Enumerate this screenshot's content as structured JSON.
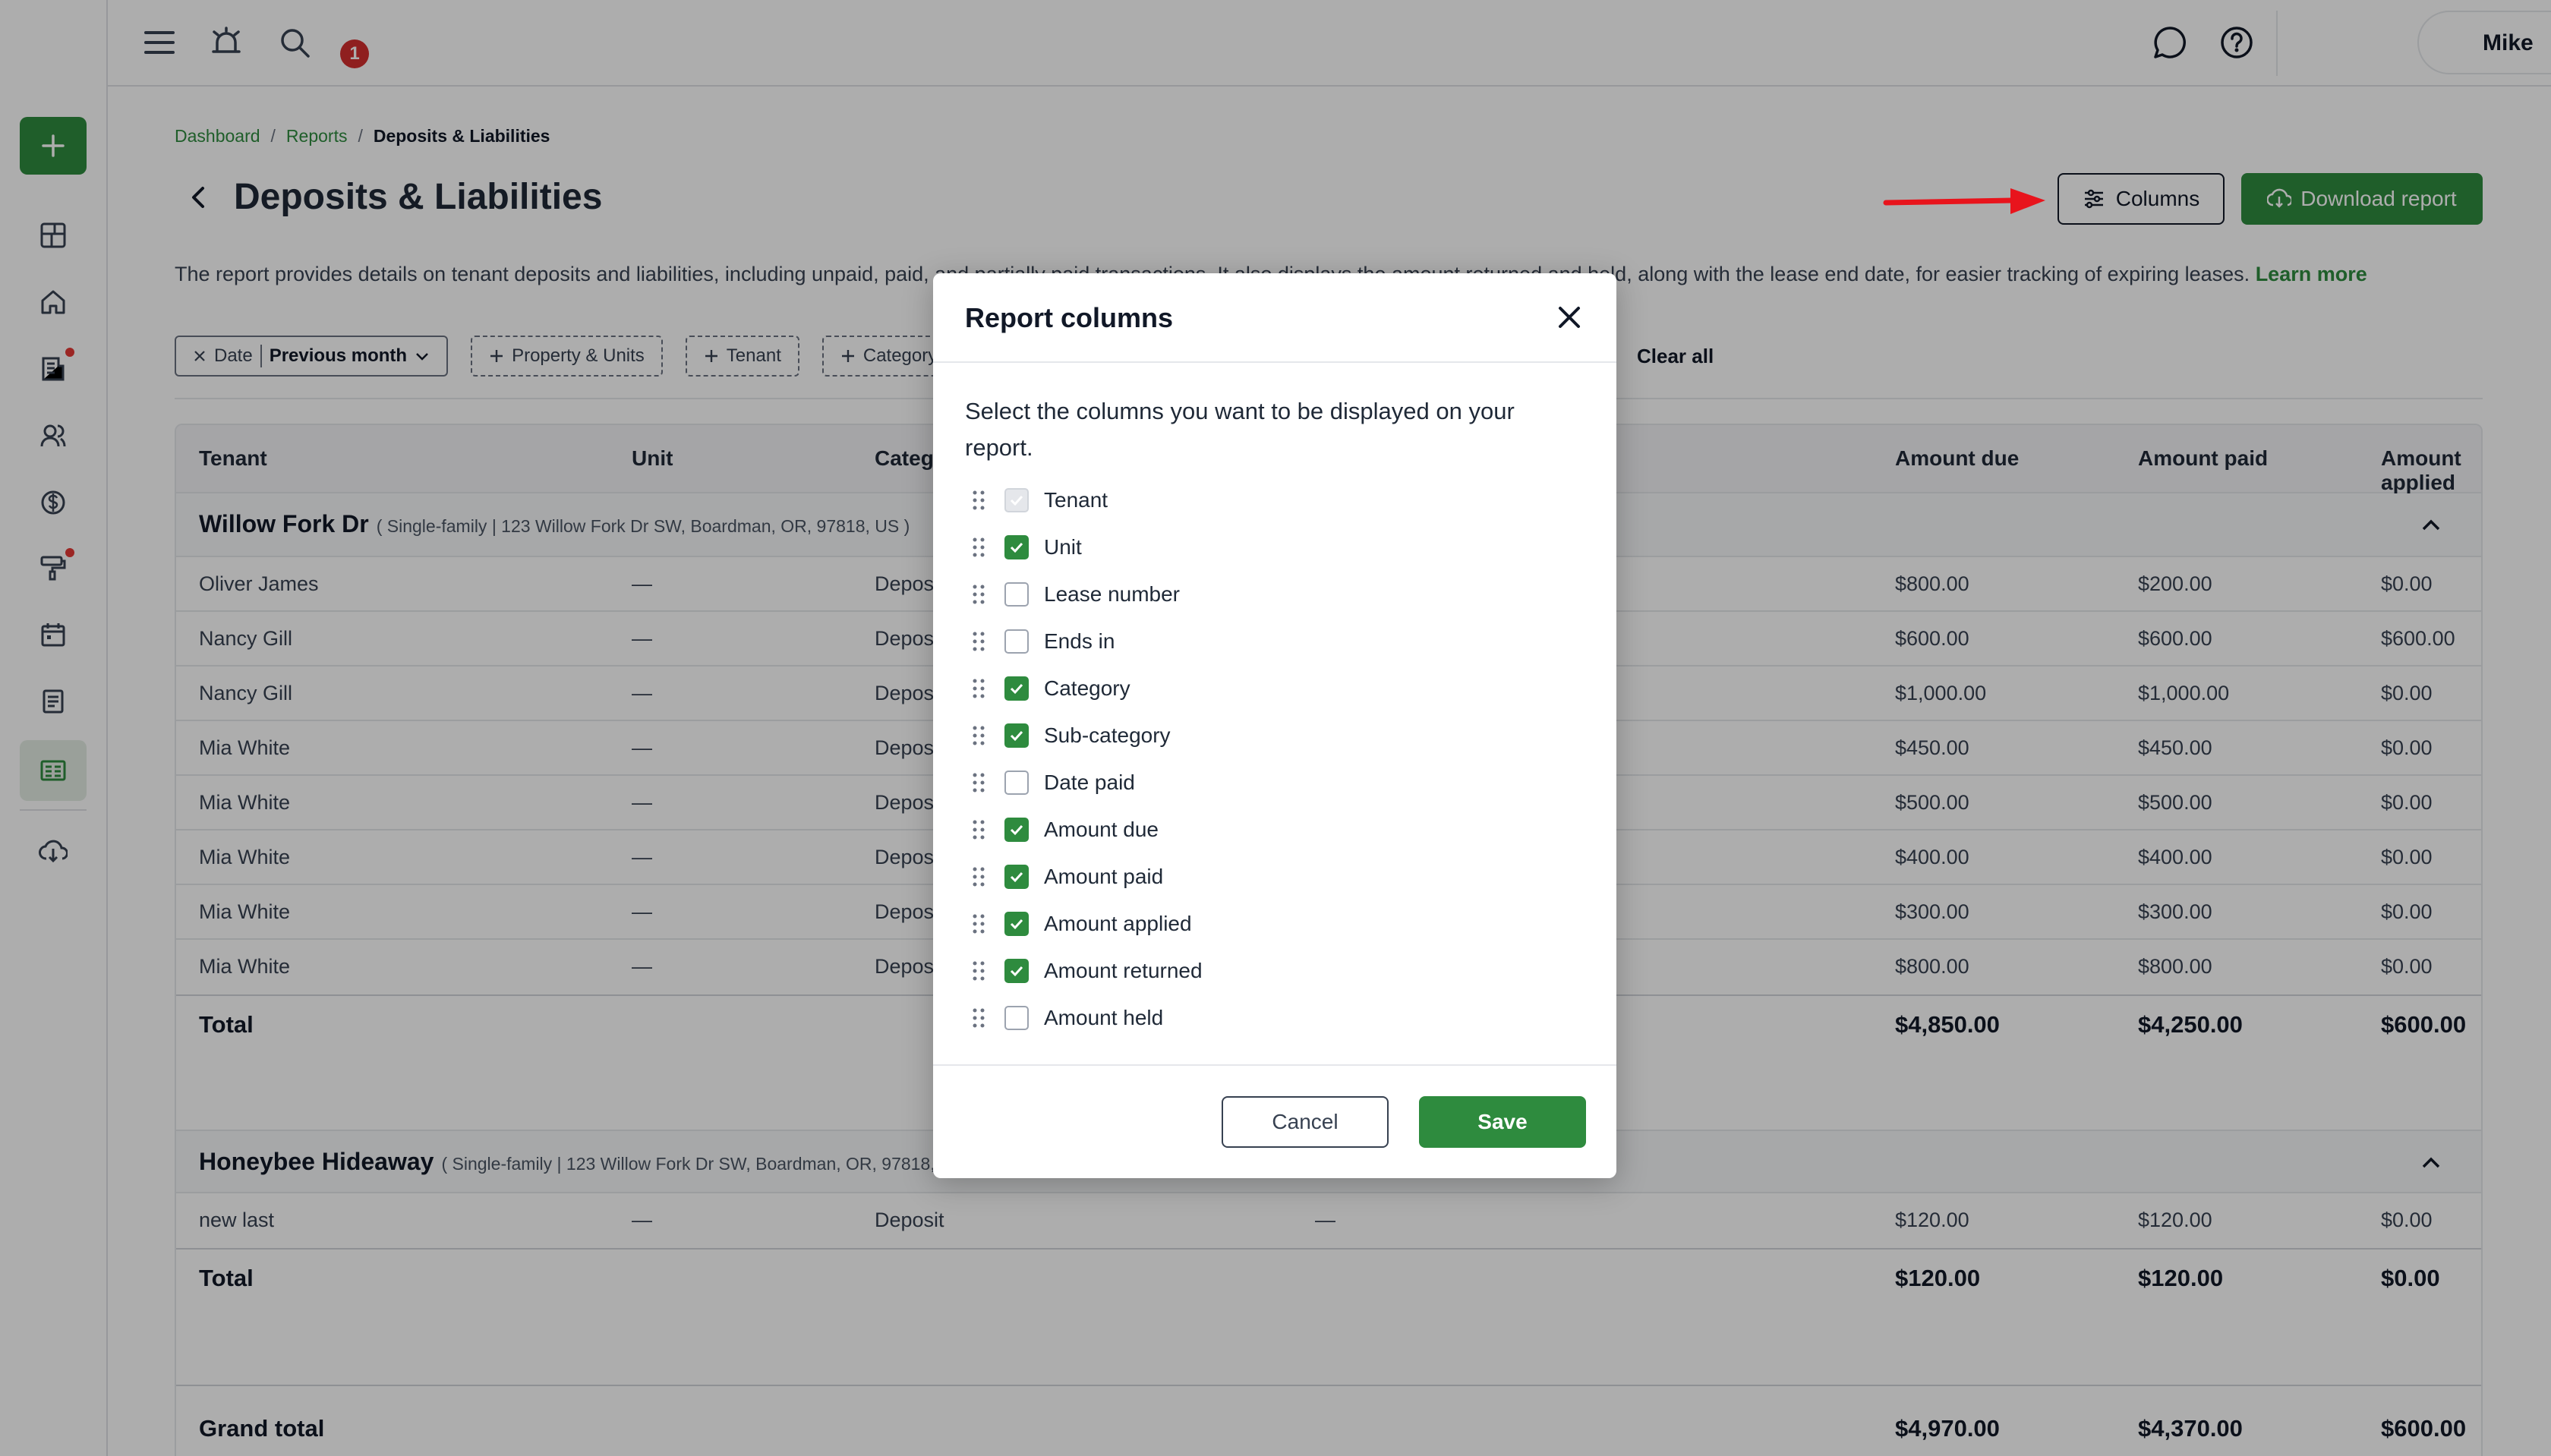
{
  "topbar": {
    "notification_count": "1",
    "user_name": "Mike"
  },
  "sidebar": {
    "items": [
      {
        "icon": "dashboard-icon"
      },
      {
        "icon": "home-icon"
      },
      {
        "icon": "reports-building-icon",
        "badge": true
      },
      {
        "icon": "people-icon"
      },
      {
        "icon": "dollar-icon"
      },
      {
        "icon": "maintenance-roller-icon",
        "badge": true
      },
      {
        "icon": "calendar-icon"
      },
      {
        "icon": "document-icon"
      },
      {
        "icon": "reports-icon",
        "active": true
      },
      {
        "icon": "download-cloud-icon"
      }
    ]
  },
  "breadcrumb": {
    "items": [
      "Dashboard",
      "Reports",
      "Deposits & Liabilities"
    ]
  },
  "page": {
    "title": "Deposits & Liabilities",
    "columns_label": "Columns",
    "download_label": "Download report",
    "description": "The report provides details on tenant deposits and liabilities, including unpaid, paid, and partially paid transactions. It also displays the amount returned and held, along with the lease end date, for easier tracking of expiring leases.",
    "learn_more": "Learn more"
  },
  "filters": {
    "date_label": "Date",
    "date_value": "Previous month",
    "chips": [
      "Property & Units",
      "Tenant",
      "Category"
    ],
    "clear_all": "Clear all"
  },
  "table": {
    "headers": {
      "tenant": "Tenant",
      "unit": "Unit",
      "category": "Category",
      "amount_due": "Amount due",
      "amount_paid": "Amount paid",
      "amount_applied": "Amount applied"
    },
    "groups": [
      {
        "name": "Willow Fork Dr",
        "address": "( Single-family | 123 Willow Fork Dr SW, Boardman, OR, 97818, US )",
        "rows": [
          {
            "tenant": "Oliver James",
            "unit": "—",
            "category": "Deposit",
            "due": "$800.00",
            "paid": "$200.00",
            "applied": "$0.00"
          },
          {
            "tenant": "Nancy Gill",
            "unit": "—",
            "category": "Deposit",
            "due": "$600.00",
            "paid": "$600.00",
            "applied": "$600.00"
          },
          {
            "tenant": "Nancy Gill",
            "unit": "—",
            "category": "Deposit",
            "due": "$1,000.00",
            "paid": "$1,000.00",
            "applied": "$0.00"
          },
          {
            "tenant": "Mia White",
            "unit": "—",
            "category": "Deposit",
            "due": "$450.00",
            "paid": "$450.00",
            "applied": "$0.00"
          },
          {
            "tenant": "Mia White",
            "unit": "—",
            "category": "Deposit",
            "due": "$500.00",
            "paid": "$500.00",
            "applied": "$0.00"
          },
          {
            "tenant": "Mia White",
            "unit": "—",
            "category": "Deposit",
            "due": "$400.00",
            "paid": "$400.00",
            "applied": "$0.00"
          },
          {
            "tenant": "Mia White",
            "unit": "—",
            "category": "Deposit",
            "due": "$300.00",
            "paid": "$300.00",
            "applied": "$0.00"
          },
          {
            "tenant": "Mia White",
            "unit": "—",
            "category": "Deposit",
            "due": "$800.00",
            "paid": "$800.00",
            "applied": "$0.00"
          }
        ],
        "total": {
          "label": "Total",
          "due": "$4,850.00",
          "paid": "$4,250.00",
          "applied": "$600.00"
        }
      },
      {
        "name": "Honeybee Hideaway",
        "address": "( Single-family | 123 Willow Fork Dr SW, Boardman, OR, 97818, US )",
        "rows": [
          {
            "tenant": "new last",
            "unit": "—",
            "category": "Deposit",
            "subcategory": "—",
            "due": "$120.00",
            "paid": "$120.00",
            "applied": "$0.00"
          }
        ],
        "total": {
          "label": "Total",
          "due": "$120.00",
          "paid": "$120.00",
          "applied": "$0.00"
        }
      }
    ],
    "grand_total": {
      "label": "Grand total",
      "due": "$4,970.00",
      "paid": "$4,370.00",
      "applied": "$600.00"
    }
  },
  "modal": {
    "title": "Report columns",
    "description": "Select the columns you want to be displayed on your report.",
    "columns": [
      {
        "label": "Tenant",
        "state": "disabled-checked"
      },
      {
        "label": "Unit",
        "state": "checked"
      },
      {
        "label": "Lease number",
        "state": "unchecked"
      },
      {
        "label": "Ends in",
        "state": "unchecked"
      },
      {
        "label": "Category",
        "state": "checked"
      },
      {
        "label": "Sub-category",
        "state": "checked"
      },
      {
        "label": "Date paid",
        "state": "unchecked"
      },
      {
        "label": "Amount due",
        "state": "checked"
      },
      {
        "label": "Amount paid",
        "state": "checked"
      },
      {
        "label": "Amount applied",
        "state": "checked"
      },
      {
        "label": "Amount returned",
        "state": "checked"
      },
      {
        "label": "Amount held",
        "state": "unchecked"
      }
    ],
    "cancel_label": "Cancel",
    "save_label": "Save"
  },
  "colors": {
    "brand_green": "#2e8b3e",
    "annotation_red": "#e8141c"
  }
}
